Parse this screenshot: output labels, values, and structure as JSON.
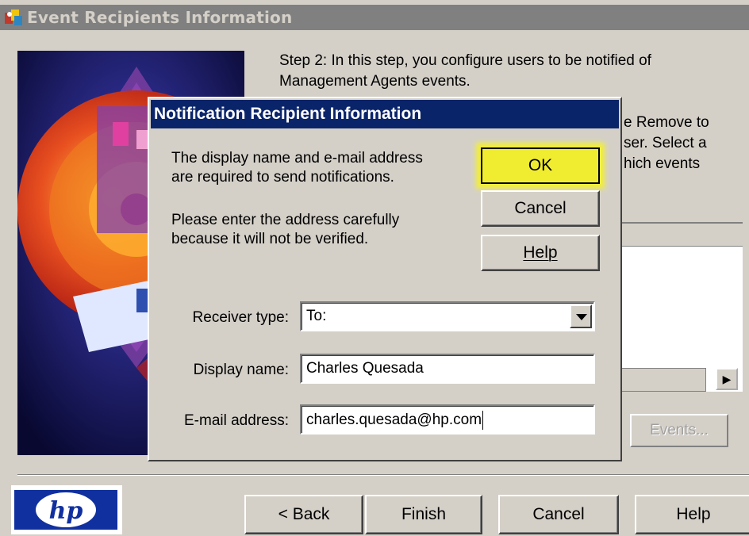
{
  "wizard": {
    "title": "Event Recipients Information",
    "step_text_line1": "Step 2:  In this step, you configure users to be notified of",
    "step_text_line2": "Management Agents events.",
    "partial_line1": "e Remove to",
    "partial_line2": "ser. Select a",
    "partial_line3": "hich events",
    "events_button": "Events...",
    "buttons": {
      "back": "< Back",
      "finish": "Finish",
      "cancel": "Cancel",
      "help": "Help"
    },
    "logo_text": "hp"
  },
  "dialog": {
    "title": "Notification Recipient Information",
    "info_line1": "The display name and e-mail address",
    "info_line2": "are required to send notifications.",
    "warn_line1": "Please enter the address carefully",
    "warn_line2": "because it will not be verified.",
    "buttons": {
      "ok": "OK",
      "cancel": "Cancel",
      "help": "Help"
    },
    "receiver_type": {
      "label": "Receiver type:",
      "value": "To:"
    },
    "display_name": {
      "label": "Display name:",
      "value": "Charles Quesada"
    },
    "email": {
      "label": "E-mail address:",
      "value": "charles.quesada@hp.com"
    }
  },
  "colors": {
    "dialog_titlebar": "#0a246a",
    "highlight": "#f0ec30",
    "window_bg": "#d4d0c8"
  }
}
